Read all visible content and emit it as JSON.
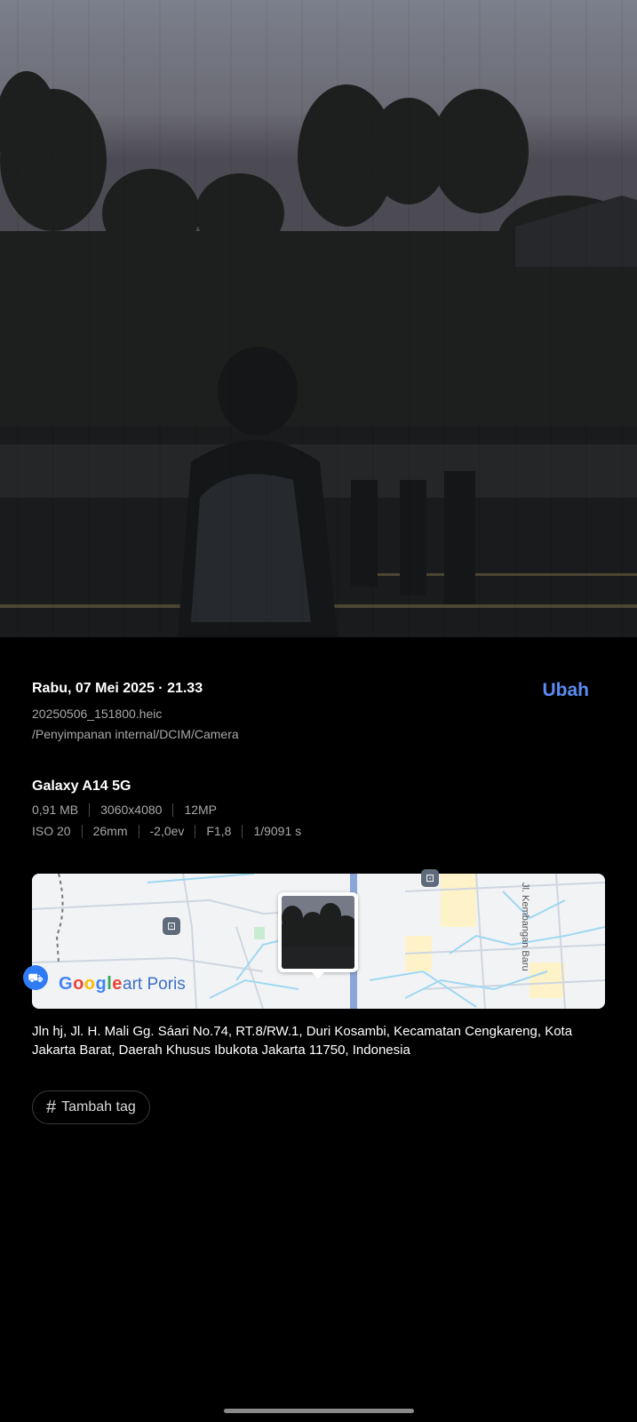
{
  "photo": {
    "alt_name": "photo-preview"
  },
  "details": {
    "date_time": "Rabu, 07 Mei 2025 · 21.33",
    "edit_label": "Ubah",
    "file_name": "20250506_151800.heic",
    "file_path": "/Penyimpanan internal/DCIM/Camera"
  },
  "camera": {
    "device": "Galaxy A14 5G",
    "size": "0,91 MB",
    "resolution": "3060x4080",
    "megapixels": "12MP",
    "iso": "ISO 20",
    "focal_length": "26mm",
    "exposure_value": "-2,0ev",
    "aperture": "F1,8",
    "shutter": "1/9091 s"
  },
  "map": {
    "logo_letters": [
      "G",
      "o",
      "o",
      "g",
      "l",
      "e"
    ],
    "place_label": "art Poris",
    "road_label": "Jl. Kembangan Baru",
    "accent": "#2f7bf5"
  },
  "location": {
    "address": "Jln hj, Jl. H. Mali Gg. Sáari No.74, RT.8/RW.1, Duri Kosambi, Kecamatan Cengkareng, Kota Jakarta Barat, Daerah Khusus Ibukota Jakarta 11750, Indonesia"
  },
  "tags": {
    "add_label": "Tambah tag"
  },
  "colors": {
    "accent": "#5b8cf2",
    "background": "#000000",
    "secondary_text": "#a8a8a8"
  }
}
